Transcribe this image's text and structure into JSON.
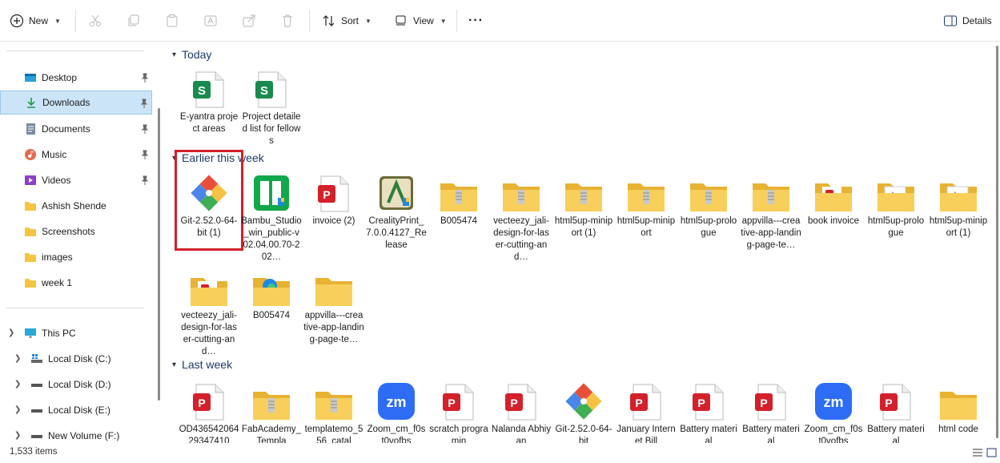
{
  "toolbar": {
    "new_label": "New",
    "sort_label": "Sort",
    "view_label": "View",
    "more_label": "···",
    "details_label": "Details"
  },
  "sidebar": {
    "quick": [
      {
        "label": "Desktop",
        "icon": "desktop-icon"
      },
      {
        "label": "Downloads",
        "icon": "download-arrow-icon"
      },
      {
        "label": "Documents",
        "icon": "documents-icon"
      },
      {
        "label": "Music",
        "icon": "music-icon"
      },
      {
        "label": "Videos",
        "icon": "videos-icon"
      },
      {
        "label": "Ashish Shende",
        "icon": "folder-icon"
      },
      {
        "label": "Screenshots",
        "icon": "folder-icon"
      },
      {
        "label": "images",
        "icon": "folder-icon"
      },
      {
        "label": "week 1",
        "icon": "folder-icon"
      }
    ],
    "this_pc": "This PC",
    "drives": [
      {
        "label": "Local Disk (C:)"
      },
      {
        "label": "Local Disk (D:)"
      },
      {
        "label": "Local Disk (E:)"
      },
      {
        "label": "New Volume (F:)"
      }
    ]
  },
  "groups": {
    "today": "Today",
    "earlier": "Earlier this week",
    "last_week": "Last week"
  },
  "files": {
    "today": [
      {
        "name": "E-yantra project areas",
        "icon": "sheets-icon"
      },
      {
        "name": "Project detailed list for fellows",
        "icon": "sheets-icon"
      }
    ],
    "earlier_row1": [
      {
        "name": "Git-2.52.0-64-bit (1)",
        "icon": "git-icon"
      },
      {
        "name": "Bambu_Studio_win_public-v02.04.00.70-202…",
        "icon": "bambu-icon"
      },
      {
        "name": "invoice (2)",
        "icon": "pdf-icon"
      },
      {
        "name": "CrealityPrint_7.0.0.4127_Release",
        "icon": "creality-icon"
      },
      {
        "name": "B005474",
        "icon": "zip-folder-icon"
      },
      {
        "name": "vecteezy_jali-design-for-laser-cutting-and…",
        "icon": "zip-folder-icon"
      },
      {
        "name": "html5up-miniport (1)",
        "icon": "zip-folder-icon"
      },
      {
        "name": "html5up-miniport",
        "icon": "zip-folder-icon"
      },
      {
        "name": "html5up-prologue",
        "icon": "zip-folder-icon"
      },
      {
        "name": "appvilla---creative-app-landing-page-te…",
        "icon": "zip-folder-icon"
      },
      {
        "name": "book invoice",
        "icon": "pdf-folder-icon"
      },
      {
        "name": "html5up-prologue",
        "icon": "image-folder-icon"
      },
      {
        "name": "html5up-miniport (1)",
        "icon": "image-folder-icon"
      }
    ],
    "earlier_row2": [
      {
        "name": "vecteezy_jali-design-for-laser-cutting-and…",
        "icon": "pdf-folder-icon"
      },
      {
        "name": "B005474",
        "icon": "edge-folder-icon"
      },
      {
        "name": "appvilla---creative-app-landing-page-te…",
        "icon": "folder-icon"
      }
    ],
    "last_week": [
      {
        "name": "OD43654206429347410",
        "icon": "pdf-icon"
      },
      {
        "name": "FabAcademy_Templa",
        "icon": "zip-folder-icon"
      },
      {
        "name": "templatemo_556_catal",
        "icon": "zip-folder-icon"
      },
      {
        "name": "Zoom_cm_f0st0vofbs",
        "icon": "zoom-icon"
      },
      {
        "name": "scratch programin",
        "icon": "pdf-icon"
      },
      {
        "name": "Nalanda Abhiyan",
        "icon": "pdf-icon"
      },
      {
        "name": "Git-2.52.0-64-bit",
        "icon": "git-icon"
      },
      {
        "name": "January Internet Bill",
        "icon": "pdf-icon"
      },
      {
        "name": "Battery material",
        "icon": "pdf-icon"
      },
      {
        "name": "Battery material",
        "icon": "pdf-icon"
      },
      {
        "name": "Zoom_cm_f0st0vofbs",
        "icon": "zoom-icon"
      },
      {
        "name": "Battery material",
        "icon": "pdf-icon"
      },
      {
        "name": "html code",
        "icon": "folder-icon"
      }
    ]
  },
  "status": {
    "item_count": "1,533 items"
  },
  "colors": {
    "selected_bg": "#cce4f7",
    "group_header": "#1f3a6e",
    "highlight_box": "#d3202a",
    "folder": "#f5c542"
  }
}
